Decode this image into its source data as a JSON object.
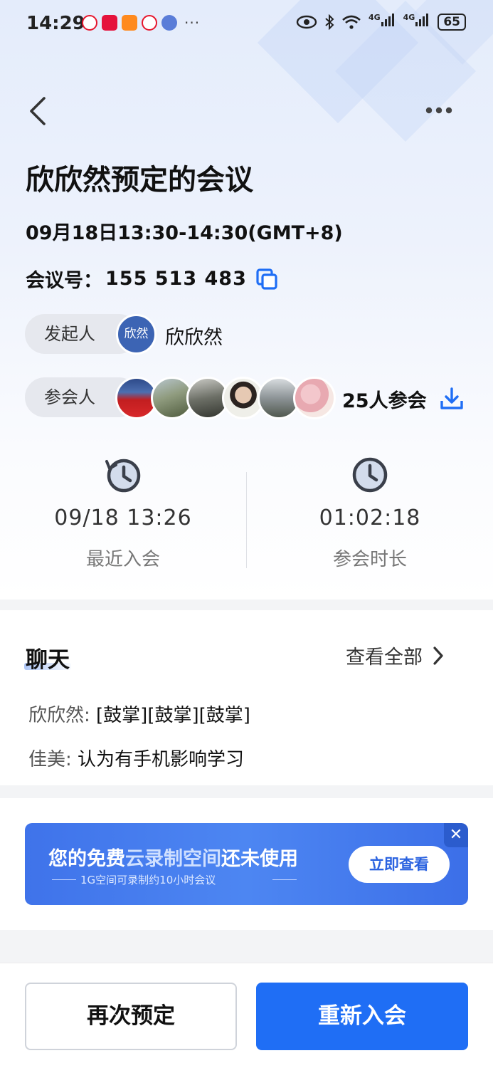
{
  "status_bar": {
    "time": "14:29",
    "notification_icons": [
      "weibo-icon",
      "xiaohongshu-icon",
      "video-player-icon",
      "weibo-icon",
      "music-icon"
    ],
    "more": "···",
    "signal1": "4G",
    "signal2": "4G",
    "battery": "65"
  },
  "header": {
    "title": "欣欣然预定的会议",
    "datetime": "09月18日13:30-14:30(GMT+8)",
    "meeting_no_label": "会议号：",
    "meeting_no": "155 513 483"
  },
  "host": {
    "label": "发起人",
    "avatar_text": "欣然",
    "name": "欣欣然"
  },
  "attendees": {
    "label": "参会人",
    "count_text": "25人参会"
  },
  "stats": {
    "last_join_value": "09/18 13:26",
    "last_join_label": "最近入会",
    "duration_value": "01:02:18",
    "duration_label": "参会时长"
  },
  "chat": {
    "title": "聊天",
    "view_all": "查看全部",
    "messages": [
      {
        "sender": "欣欣然:",
        "text": "[鼓掌][鼓掌][鼓掌]"
      },
      {
        "sender": "佳美:",
        "text": "认为有手机影响学习"
      }
    ]
  },
  "banner": {
    "text_pre": "您的免费",
    "text_hi": "云录制空间",
    "text_post": "还未使用",
    "subtext": "1G空间可录制约10小时会议",
    "cta": "立即查看",
    "close": "✕"
  },
  "actions": {
    "book_again": "再次预定",
    "rejoin": "重新入会"
  },
  "colors": {
    "accent": "#1f6ef5",
    "host_avatar": "#3c64b4",
    "banner": "#4d86f2"
  }
}
